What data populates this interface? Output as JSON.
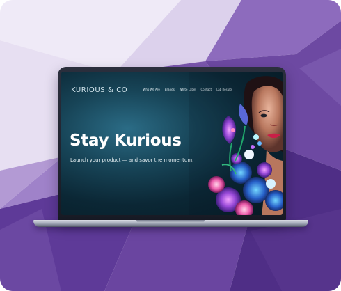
{
  "website": {
    "brand": "KURIOUS & CO",
    "nav": [
      {
        "label": "Who We Are"
      },
      {
        "label": "Brands"
      },
      {
        "label": "White Label"
      },
      {
        "label": "Contact"
      },
      {
        "label": "Lab Results"
      }
    ],
    "hero": {
      "title": "Stay Kurious",
      "subtitle": "Launch your product — and savor the momentum."
    }
  },
  "colors": {
    "purple_primary": "#6f46a3",
    "purple_dark": "#4f2e86",
    "purple_light": "#9b78c6",
    "screen_teal": "#174457",
    "text_white": "#ffffff"
  },
  "icons": {
    "hero_image": "woman-with-flowers-image"
  }
}
